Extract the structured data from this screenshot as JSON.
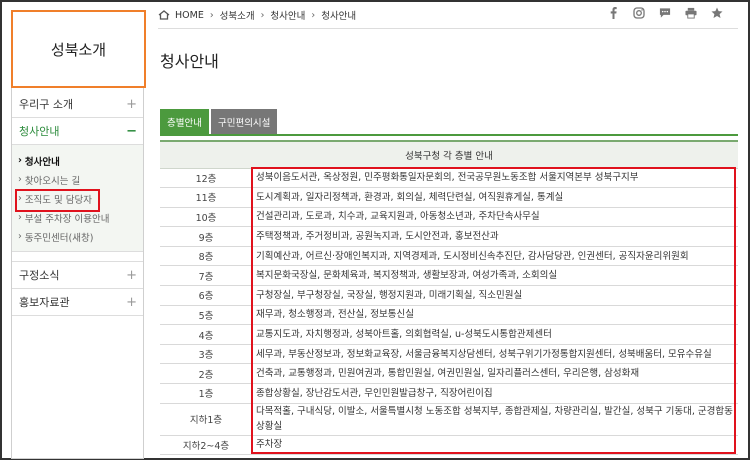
{
  "sidebar": {
    "title": "성북소개",
    "items": [
      {
        "label": "우리구 소개",
        "sign": "+"
      },
      {
        "label": "청사안내",
        "sign": "−"
      }
    ],
    "sub_items": [
      {
        "label": "청사안내"
      },
      {
        "label": "찾아오시는 길"
      },
      {
        "label": "조직도 및 담당자"
      },
      {
        "label": "부설 주차장 이용안내"
      },
      {
        "label": "동주민센터(새창)"
      }
    ],
    "bottom_items": [
      {
        "label": "구정소식",
        "sign": "+"
      },
      {
        "label": "홍보자료관",
        "sign": "+"
      }
    ]
  },
  "breadcrumb": {
    "home": "HOME",
    "level1": "성북소개",
    "level2": "청사안내",
    "level3": "청사안내"
  },
  "social_icons": [
    "facebook-icon",
    "instagram-icon",
    "chat-icon",
    "print-icon",
    "star-icon"
  ],
  "page_title": "청사안내",
  "tabs": [
    {
      "label": "층별안내"
    },
    {
      "label": "구민편의시설"
    }
  ],
  "table": {
    "header": "성북구청 각 층별 안내",
    "rows": [
      {
        "floor": "12층",
        "dept": "성북이음도서관, 옥상정원, 민주평화통일자문회의, 전국공무원노동조합 서울지역본부 성북구지부"
      },
      {
        "floor": "11층",
        "dept": "도시계획과, 일자리정책과, 환경과, 회의실, 체력단련실, 여직원휴게실, 통계실"
      },
      {
        "floor": "10층",
        "dept": "건설관리과, 도로과, 치수과, 교육지원과, 아동청소년과, 주차단속사무실"
      },
      {
        "floor": "9층",
        "dept": "주택정책과, 주거정비과, 공원녹지과, 도시안전과, 홍보전산과"
      },
      {
        "floor": "8층",
        "dept": "기획예산과, 어르신·장애인복지과, 지역경제과, 도시정비신속추진단, 감사담당관, 인권센터, 공직자윤리위원회"
      },
      {
        "floor": "7층",
        "dept": "복지문화국장실, 문화체육과, 복지정책과, 생활보장과, 여성가족과, 소회의실"
      },
      {
        "floor": "6층",
        "dept": "구청장실, 부구청장실, 국장실, 행정지원과, 미래기획실, 직소민원실"
      },
      {
        "floor": "5층",
        "dept": "재무과, 청소행정과, 전산실, 정보통신실"
      },
      {
        "floor": "4층",
        "dept": "교통지도과, 자치행정과, 성북아트홀, 의회협력실, u-성북도시통합관제센터"
      },
      {
        "floor": "3층",
        "dept": "세무과, 부동산정보과, 정보화교육장, 서울금융복지상담센터, 성북구위기가정통합지원센터, 성북배움터, 모유수유실"
      },
      {
        "floor": "2층",
        "dept": "건축과, 교통행정과, 민원여권과, 통합민원실, 여권민원실, 일자리플러스센터, 우리은행, 삼성화재"
      },
      {
        "floor": "1층",
        "dept": "종합상황실, 장난감도서관, 무인민원발급창구, 직장어린이집"
      },
      {
        "floor": "지하1층",
        "dept": "다목적홀, 구내식당, 이발소, 서울특별시청 노동조합 성북지부, 종합관제실, 차량관리실, 발간실, 성북구 기동대, 군경합동상황실"
      },
      {
        "floor": "지하2~4층",
        "dept": "주차장"
      }
    ]
  },
  "colors": {
    "accent_green": "#4c9a3e",
    "highlight_red": "#e0121d",
    "title_orange": "#f07f2a"
  }
}
